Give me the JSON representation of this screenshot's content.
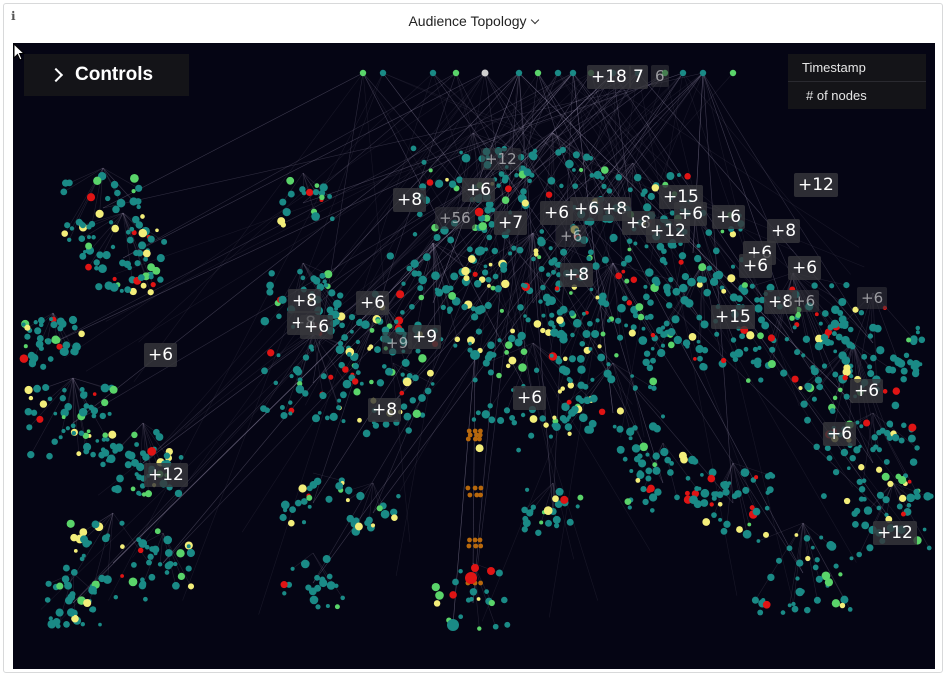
{
  "panel": {
    "title": "Audience Topology",
    "info_icon": "info-icon",
    "dropdown_icon": "chevron-down-icon"
  },
  "controls": {
    "label": "Controls",
    "icon": "chevron-right-icon"
  },
  "legend": {
    "items": [
      "Timestamp",
      "# of nodes"
    ]
  },
  "colors": {
    "background": "#050514",
    "node_teal": "#1a8a86",
    "node_green": "#5ad46a",
    "node_yellow": "#f3ee7a",
    "node_red": "#e01414",
    "node_orange": "#b8680c",
    "edge": "#a49bb8"
  },
  "cluster_labels": [
    "+18",
    "7",
    "6",
    "+12",
    "+6",
    "+8",
    "+56",
    "+7",
    "+6",
    "+6",
    "+8",
    "+15",
    "+6",
    "+12",
    "+6",
    "+8",
    "+12",
    "+6",
    "+8",
    "+6",
    "+6",
    "+8",
    "+6",
    "+8",
    "+6",
    "+8",
    "+6",
    "+9",
    "+9",
    "+6",
    "+15",
    "+8",
    "+6",
    "+6",
    "+12",
    "+8",
    "+6",
    "+6",
    "+6",
    "+12"
  ]
}
